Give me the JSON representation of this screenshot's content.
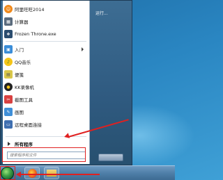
{
  "start_menu": {
    "programs": [
      {
        "label": "阿里旺旺2014",
        "icon": "aliwangwang-icon",
        "color": "#f08a1c"
      },
      {
        "label": "计算器",
        "icon": "calculator-icon",
        "color": "#5a6b7d"
      },
      {
        "label": "Frozen Throne.exe",
        "icon": "frozen-throne-icon",
        "color": "#2b4c6e"
      },
      {
        "label": "入门",
        "icon": "getting-started-icon",
        "color": "#3a8dd8",
        "has_submenu": true
      },
      {
        "label": "QQ音乐",
        "icon": "qqmusic-icon",
        "color": "#f5c518"
      },
      {
        "label": "便笺",
        "icon": "sticky-notes-icon",
        "color": "#d9c74a"
      },
      {
        "label": "KK录像机",
        "icon": "kk-recorder-icon",
        "color": "#222222"
      },
      {
        "label": "截图工具",
        "icon": "snipping-tool-icon",
        "color": "#d84141"
      },
      {
        "label": "画图",
        "icon": "paint-icon",
        "color": "#3f8fd8"
      },
      {
        "label": "远程桌面连接",
        "icon": "remote-desktop-icon",
        "color": "#3f6fb0"
      }
    ],
    "all_programs_label": "所有程序",
    "search_placeholder": "搜索程序和文件",
    "right_pane": {
      "run_label": "运行..."
    }
  },
  "taskbar": {
    "apps": [
      "firefox-icon",
      "folder-icon"
    ]
  },
  "annotation_color": "#e02020"
}
